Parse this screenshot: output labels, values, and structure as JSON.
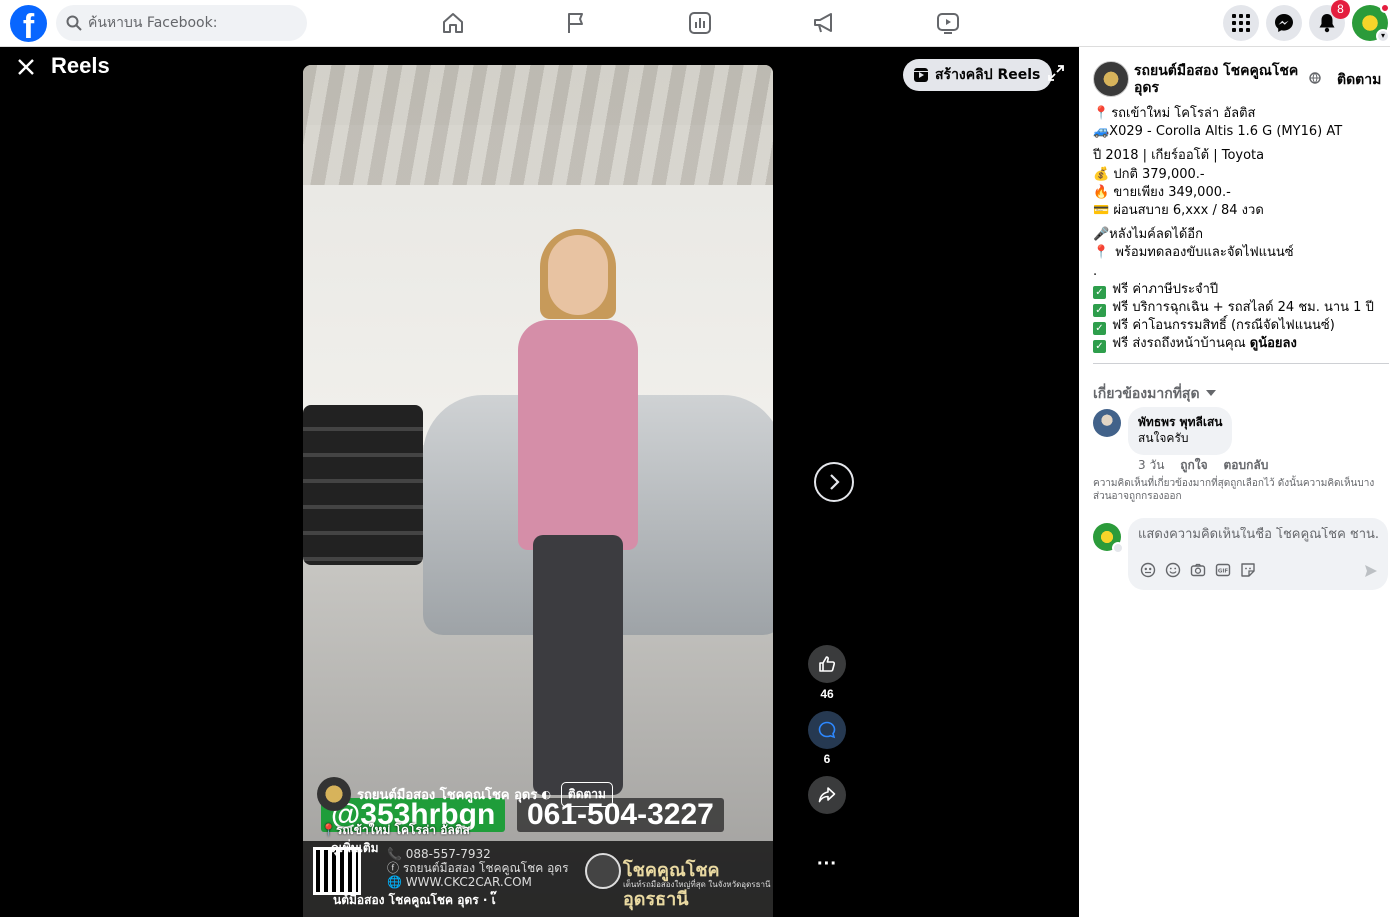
{
  "topbar": {
    "logo_letter": "f",
    "search_placeholder": "ค้นหาบน Facebook:",
    "notification_count": "8"
  },
  "viewer": {
    "title": "Reels",
    "create_reel_label": "สร้างคลิป Reels",
    "reel": {
      "author": "รถยนต์มือสอง โชคคูณโชค อุดร",
      "follow_label": "ติดตาม",
      "caption": "รถเข้าใหม่ โคโรล่า อัลติส",
      "see_more": "ดูเพิ่มเติม",
      "author_dupe": "นต์มือสอง โชคคูณโชค อุดร · เ๊",
      "overlay": {
        "line_id": "@353hrbgn",
        "phone_big": "061-504-3227",
        "phone_small": "088-557-7932",
        "page_small": "รถยนต์มือสอง โชคคูณโชค อุดร",
        "website": "WWW.CKC2CAR.COM",
        "qr_label": "LINE",
        "logo_text": "โชคคูณโชค อุดรธานี",
        "logo_sub": "เต็นท์รถมือสองใหญ่ที่สุด ในจังหวัดอุดรธานี"
      }
    },
    "actions": {
      "like_count": "46",
      "comment_count": "6"
    }
  },
  "panel": {
    "page_name": "รถยนต์มือสอง โชคคูณโชค อุดร",
    "follow_label": "ติดตาม",
    "description": {
      "l1": "รถเข้าใหม่ โคโรล่า อัลติส",
      "l2": "🚙X029 - Corolla Altis 1.6 G (MY16) AT",
      "l3": "ปี 2018 | เกียร์ออโต้ | Toyota",
      "l4": "💰 ปกติ 379,000.-",
      "l5": "🔥 ขายเพียง 349,000.-",
      "l6": "💳 ผ่อนสบาย 6,xxx / 84 งวด",
      "l7": "🎤หลังไมค์ลดได้อีก",
      "l8": "พร้อมทดลองขับและจัดไฟแนนซ์",
      "l9": ".",
      "l10": "ฟรี ค่าภาษีประจำปี",
      "l11": "ฟรี บริการฉุกเฉิน + รถสไลด์ 24 ชม. นาน 1 ปี",
      "l12": "ฟรี ค่าโอนกรรมสิทธิ์ (กรณีจัดไฟแนนซ์)",
      "l13_prefix": "ฟรี ส่งรถถึงหน้าบ้านคุณ",
      "l13_more": "ดูน้อยลง"
    },
    "sort_label": "เกี่ยวข้องมากที่สุด",
    "comment": {
      "author": "พัทธพร พุทลีเสน",
      "text": "สนใจครับ",
      "time": "3 วัน",
      "like": "ถูกใจ",
      "reply": "ตอบกลับ"
    },
    "relevance_note": "ความคิดเห็นที่เกี่ยวข้องมากที่สุดถูกเลือกไว้ ดังนั้นความคิดเห็นบางส่วนอาจถูกกรองออก",
    "composer_placeholder": "แสดงความคิดเห็นในชื่อ โชคคูณโชค ชาน..."
  }
}
